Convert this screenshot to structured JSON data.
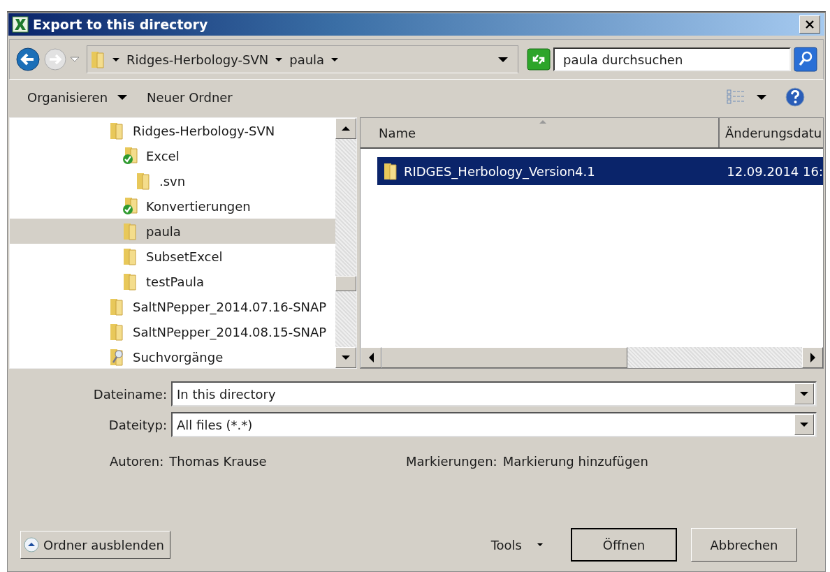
{
  "window": {
    "title": "Export to this directory"
  },
  "address": {
    "breadcrumbs": [
      "Ridges-Herbology-SVN",
      "paula"
    ]
  },
  "search": {
    "placeholder": "paula durchsuchen"
  },
  "toolbar": [
    {
      "label": "Organisieren",
      "kind": "menu"
    },
    {
      "label": "Neuer Ordner",
      "kind": "button"
    }
  ],
  "tree": [
    {
      "name": "Ridges-Herbology-SVN",
      "kind": "folder",
      "selected": false,
      "children": [
        {
          "name": "Excel",
          "kind": "svn-ok",
          "selected": false,
          "children": [
            {
              "name": ".svn",
              "kind": "folder",
              "selected": false
            }
          ]
        },
        {
          "name": "Konvertierungen",
          "kind": "svn-ok",
          "selected": false
        },
        {
          "name": "paula",
          "kind": "folder",
          "selected": true
        },
        {
          "name": "SubsetExcel",
          "kind": "folder",
          "selected": false
        },
        {
          "name": "testPaula",
          "kind": "folder",
          "selected": false
        }
      ]
    },
    {
      "name": "SaltNPepper_2014.07.16-SNAP",
      "kind": "folder",
      "selected": false
    },
    {
      "name": "SaltNPepper_2014.08.15-SNAP",
      "kind": "folder",
      "selected": false
    },
    {
      "name": "Suchvorgänge",
      "kind": "search",
      "selected": false
    }
  ],
  "columns": [
    {
      "label": "Name",
      "sorted": true
    },
    {
      "label": "Änderungsdatu",
      "sorted": false
    }
  ],
  "files": [
    {
      "name": "RIDGES_Herbology_Version4.1",
      "modified": "12.09.2014 16:",
      "selected": true
    }
  ],
  "fields": [
    {
      "label": "Dateiname:",
      "value": "In this directory"
    },
    {
      "label": "Dateityp:",
      "value": "All files (*.*)"
    }
  ],
  "metadata": [
    {
      "label": "Autoren:",
      "value": "Thomas Krause"
    },
    {
      "label": "Markierungen:",
      "value": "Markierung hinzufügen"
    }
  ],
  "hide_folders": "Ordner ausblenden",
  "tools": "Tools",
  "buttons": [
    {
      "label": "Öffnen",
      "default": true
    },
    {
      "label": "Abbrechen",
      "default": false
    }
  ]
}
